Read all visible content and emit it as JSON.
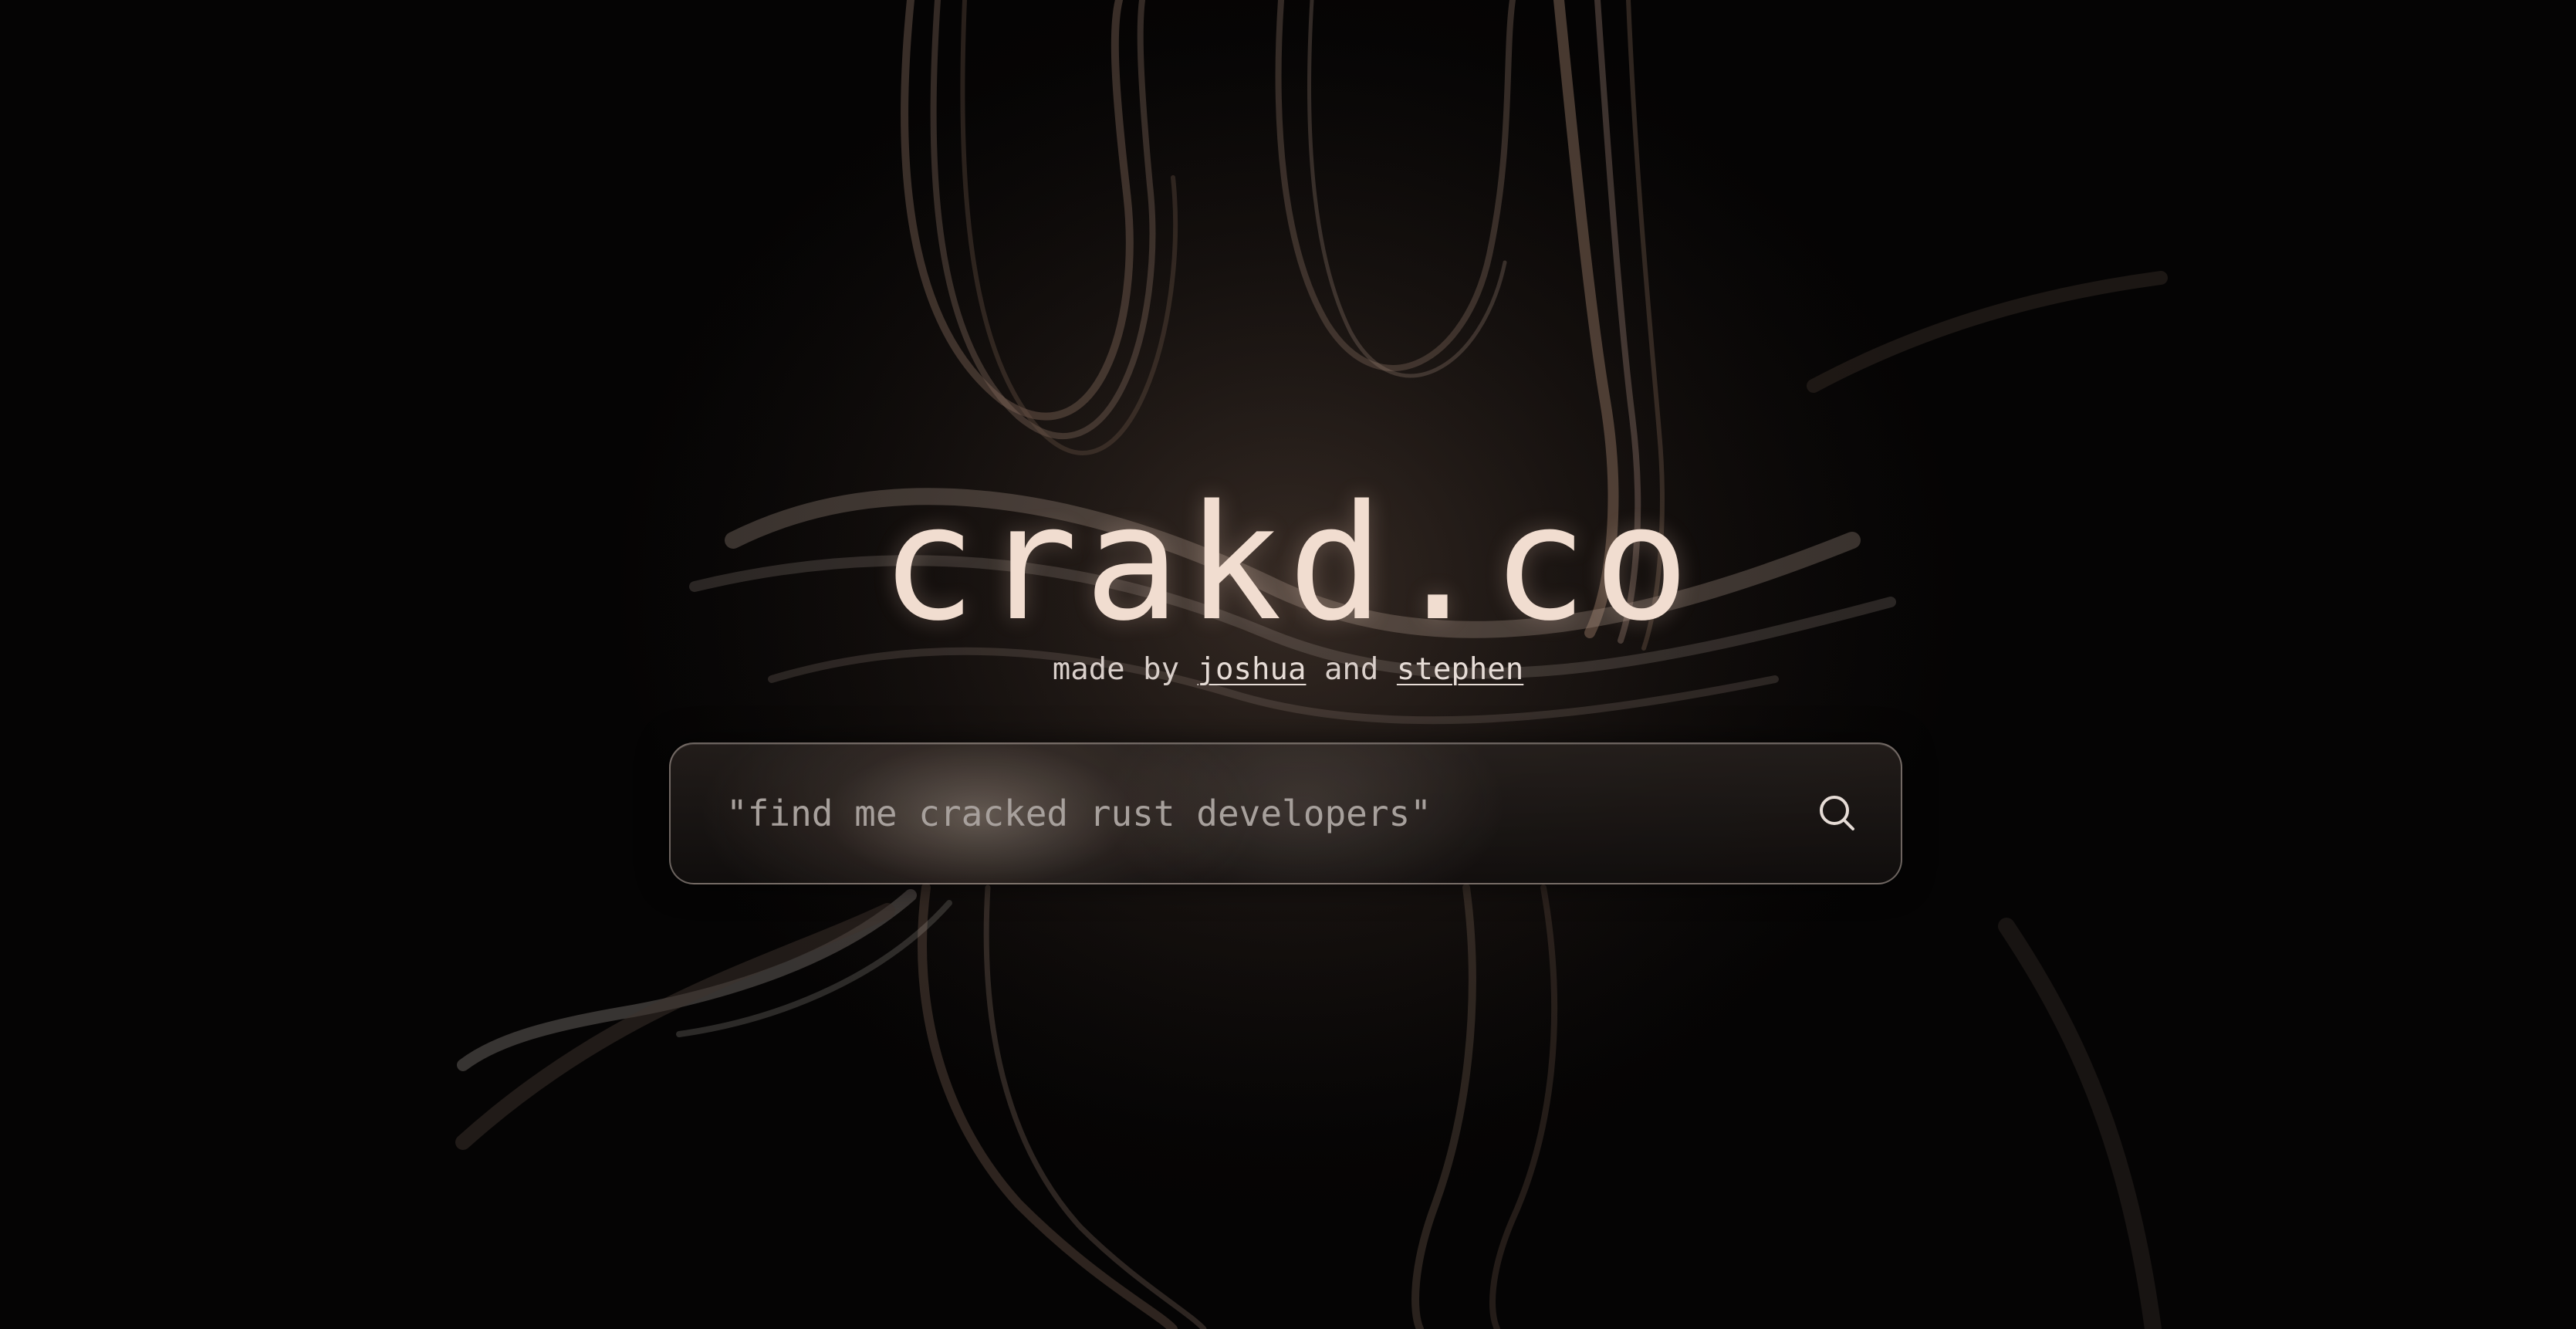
{
  "brand": {
    "title": "crakd.co"
  },
  "credits": {
    "prefix": "made by",
    "author_one": "joshua",
    "conjunction": "and",
    "author_two": "stephen"
  },
  "search": {
    "value": "",
    "placeholder": "\"find me cracked rust developers\"",
    "button_icon": "search-icon"
  },
  "colors": {
    "background": "#050404",
    "title": "#f1ddd0",
    "text": "#d9cfca",
    "strands": "#8a7366"
  }
}
